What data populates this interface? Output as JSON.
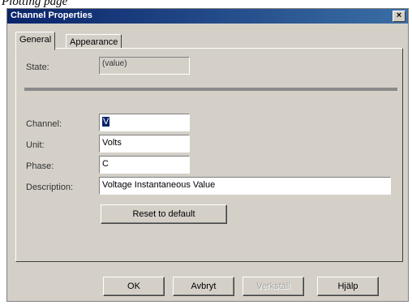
{
  "page_caption": "Plotting page",
  "dialog": {
    "title": "Channel Properties",
    "close_glyph": "×"
  },
  "tabs": [
    {
      "label": "General",
      "active": true
    },
    {
      "label": "Appearance",
      "active": false
    }
  ],
  "general": {
    "state_label": "State:",
    "state_value": "(value)",
    "channel_label": "Channel:",
    "channel_value": "V",
    "unit_label": "Unit:",
    "unit_value": "Volts",
    "phase_label": "Phase:",
    "phase_value": "C",
    "description_label": "Description:",
    "description_value": "Voltage Instantaneous Value",
    "reset_button": "Reset to default"
  },
  "footer": {
    "ok": "OK",
    "cancel": "Avbryt",
    "apply": "Verkställ",
    "help": "Hjälp"
  }
}
